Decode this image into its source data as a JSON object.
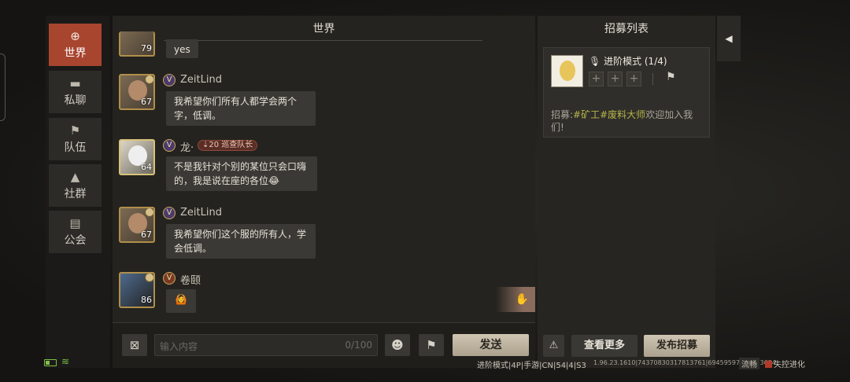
{
  "nav": {
    "items": [
      {
        "label": "世界",
        "icon": "globe-icon",
        "active": true
      },
      {
        "label": "私聊",
        "icon": "chat-icon",
        "active": false
      },
      {
        "label": "队伍",
        "icon": "flag-icon",
        "active": false
      },
      {
        "label": "社群",
        "icon": "campfire-icon",
        "active": false
      },
      {
        "label": "公会",
        "icon": "guild-banner-icon",
        "active": false
      }
    ]
  },
  "chat": {
    "title": "世界",
    "messages": [
      {
        "level": "79",
        "username": "",
        "text": "yes"
      },
      {
        "level": "67",
        "username": "ZeitLind",
        "text": "我希望你们所有人都学会两个字，低调。"
      },
      {
        "level": "64",
        "username": "龙·",
        "tag": "⇣20 巡查队长",
        "text": "不是我针对个别的某位只会口嗨的，我是说在座的各位😂"
      },
      {
        "level": "67",
        "username": "ZeitLind",
        "text": "我希望你们这个服的所有人，学会低调。"
      },
      {
        "level": "86",
        "username": "卷颐",
        "text": "🙆"
      }
    ],
    "input": {
      "placeholder": "输入内容",
      "counter": "0/100"
    },
    "send_label": "发送"
  },
  "recruit": {
    "title": "招募列表",
    "card": {
      "mode": "进阶模式 (1/4)",
      "desc_prefix": "招募:",
      "desc_tags": "#矿工#废料大师",
      "desc_suffix": "欢迎加入我们!"
    },
    "more_label": "查看更多",
    "post_label": "发布招募"
  },
  "status": {
    "server": "进阶模式|4P|手游|CN|54|4|S3",
    "version": "1.96.23.1610|74370830317813761|69459597489733634",
    "flow": "流畅",
    "logo": "失控进化"
  },
  "colors": {
    "accent": "#a8452f",
    "highlight": "#b8b54a",
    "battery": "#7fbf4a"
  }
}
